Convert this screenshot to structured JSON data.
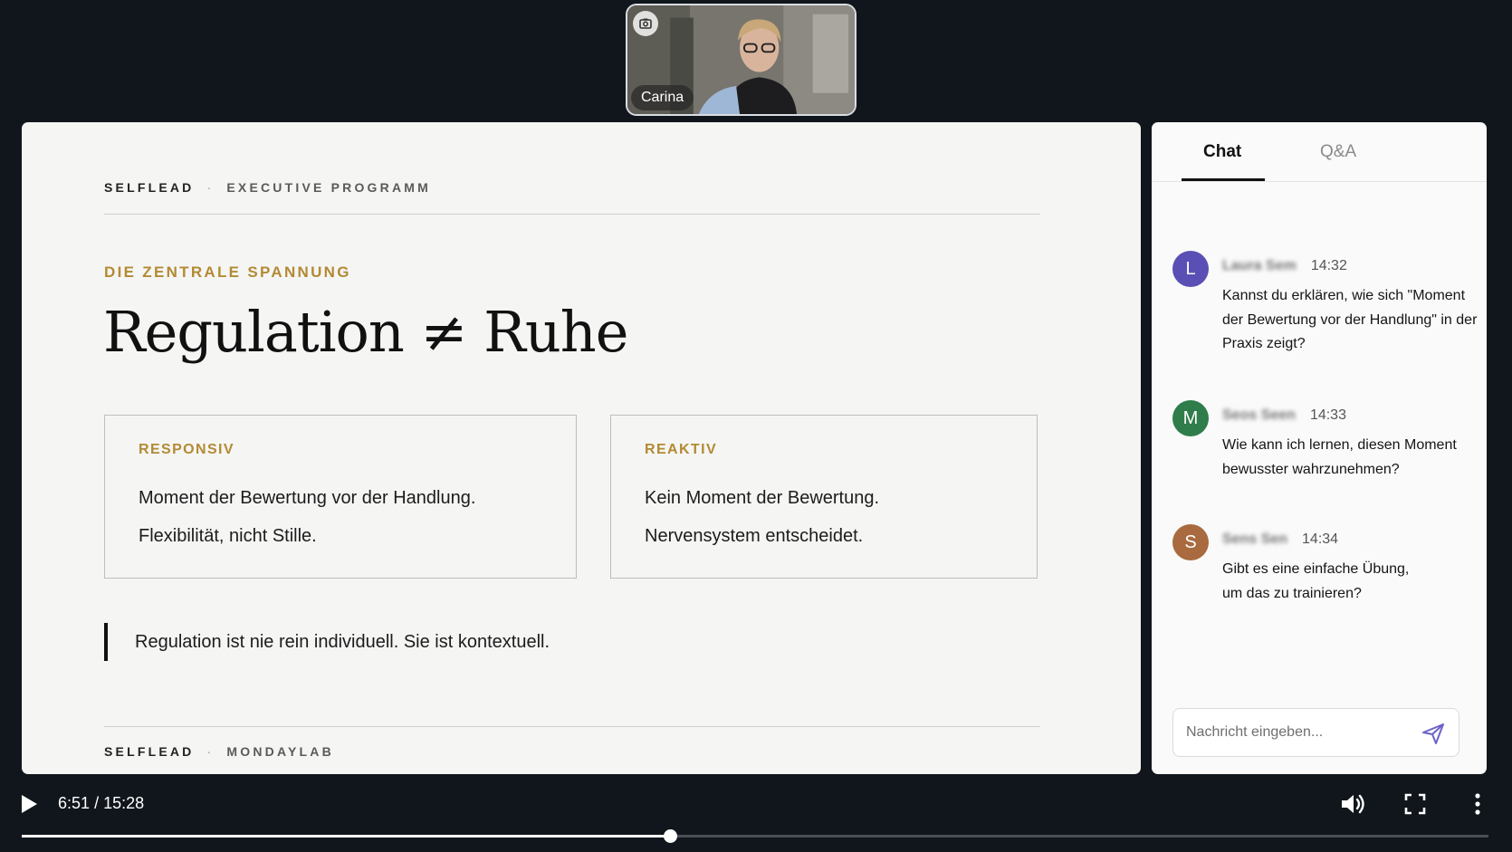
{
  "participant": {
    "name": "Carina",
    "camera_icon": "camera-icon"
  },
  "slide": {
    "header_brand": "SELFLEAD",
    "header_separator": "·",
    "header_program": "EXECUTIVE PROGRAMM",
    "kicker": "DIE ZENTRALE SPANNUNG",
    "title": "Regulation ≠ Ruhe",
    "cards": [
      {
        "label": "RESPONSIV",
        "line1": "Moment der Bewertung vor der Handlung.",
        "line2": "Flexibilität, nicht Stille."
      },
      {
        "label": "REAKTIV",
        "line1": "Kein Moment der Bewertung.",
        "line2": "Nervensystem entscheidet."
      }
    ],
    "quote": "Regulation ist nie rein individuell. Sie ist kontextuell.",
    "footer_brand": "SELFLEAD",
    "footer_separator": "·",
    "footer_org": "MONDAYLAB"
  },
  "chat_panel": {
    "tabs": [
      {
        "label": "Chat",
        "active": true
      },
      {
        "label": "Q&A",
        "active": false
      }
    ],
    "messages": [
      {
        "initial": "L",
        "avatar_color": "#5a4fb5",
        "sender": "Laura Sem",
        "time": "14:32",
        "text": "Kannst du erklären, wie sich \"Moment der Bewertung vor der Handlung\" in der Praxis zeigt?"
      },
      {
        "initial": "M",
        "avatar_color": "#2f7d4a",
        "sender": "Seos Seen",
        "time": "14:33",
        "text": "Wie kann ich lernen, diesen Moment bewusster wahrzunehmen?"
      },
      {
        "initial": "S",
        "avatar_color": "#a86a3e",
        "sender": "Sens Sen",
        "time": "14:34",
        "text": "Gibt es eine einfache Übung, um das zu trainieren?"
      }
    ],
    "composer_placeholder": "Nachricht eingeben...",
    "send_icon": "send-icon"
  },
  "player": {
    "current_time": "6:51",
    "separator": "/",
    "duration": "15:28",
    "progress_fraction": 0.442,
    "accent": "#ffffff",
    "icons": [
      "play-icon",
      "volume-icon",
      "fullscreen-icon",
      "more-vertical-icon"
    ]
  }
}
